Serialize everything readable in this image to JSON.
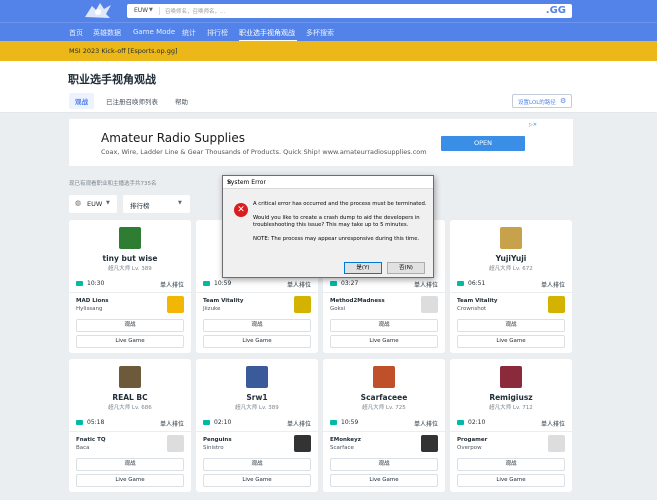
{
  "topbar": {
    "region": "EUW",
    "search_placeholder": "召唤师名，召唤师名，...",
    "brand": ".GG"
  },
  "nav": {
    "items": [
      {
        "label": "首页"
      },
      {
        "label": "英雄数据"
      },
      {
        "label": "Game Mode"
      },
      {
        "label": "统计"
      },
      {
        "label": "排行榜"
      },
      {
        "label": "职业选手视角观战"
      },
      {
        "label": "多杯搜索"
      }
    ]
  },
  "banner": {
    "text": "MSI 2023 Kick-off [Esports.op.gg]"
  },
  "header": {
    "title": "职业选手视角观战",
    "tabs": [
      {
        "label": "观战"
      },
      {
        "label": "已注册召唤师列表"
      },
      {
        "label": "帮助"
      }
    ],
    "settings_label": "设置LOL的路径"
  },
  "ad": {
    "title": "Amateur Radio Supplies",
    "description": "Coax, Wire, Ladder Line & Gear Thousands of Products. Quick Ship! www.amateurradiosupplies.com",
    "button": "OPEN"
  },
  "subtitle": "现已有观看职业和主播选手共735名",
  "filters": {
    "region": "EUW",
    "sort": "排行榜"
  },
  "cards": [
    {
      "name": "tiny but wise",
      "rank": "超凡大师 Lv. 389",
      "time": "10:30",
      "queue": "单人排位",
      "team": "MAD Lions",
      "player": "Hylissang",
      "avatar_color": "#2e7d32",
      "logo_color": "#f2b705",
      "watch": "观战",
      "live": "Live Game"
    },
    {
      "name": "",
      "rank": "",
      "time": "10:59",
      "queue": "单人排位",
      "team": "Team Vitality",
      "player": "Jiizuke",
      "avatar_color": "#777777",
      "logo_color": "#d4b300",
      "watch": "观战",
      "live": "Live Game"
    },
    {
      "name": "",
      "rank": "",
      "time": "03:27",
      "queue": "单人排位",
      "team": "Method2Madness",
      "player": "Goksi",
      "avatar_color": "#777777",
      "logo_color": "#dddddd",
      "watch": "观战",
      "live": "Live Game"
    },
    {
      "name": "YujiYuji",
      "rank": "超凡大师 Lv. 672",
      "time": "06:51",
      "queue": "单人排位",
      "team": "Team Vitality",
      "player": "Crownshot",
      "avatar_color": "#c8a24a",
      "logo_color": "#d4b300",
      "watch": "观战",
      "live": "Live Game"
    },
    {
      "name": "REAL BC",
      "rank": "超凡大师 Lv. 686",
      "time": "05:18",
      "queue": "单人排位",
      "team": "Fnatic TQ",
      "player": "Baca",
      "avatar_color": "#6d5a3a",
      "logo_color": "#dddddd",
      "watch": "观战",
      "live": "Live Game"
    },
    {
      "name": "Srw1",
      "rank": "超凡大师 Lv. 389",
      "time": "02:10",
      "queue": "单人排位",
      "team": "Penguins",
      "player": "Sinistro",
      "avatar_color": "#3a5a9a",
      "logo_color": "#333333",
      "watch": "观战",
      "live": "Live Game"
    },
    {
      "name": "Scarfaceee",
      "rank": "超凡大师 Lv. 725",
      "time": "10:59",
      "queue": "单人排位",
      "team": "EMonkeyz",
      "player": "Scarface",
      "avatar_color": "#c0502a",
      "logo_color": "#333333",
      "watch": "观战",
      "live": "Live Game"
    },
    {
      "name": "Remigiusz",
      "rank": "超凡大师 Lv. 712",
      "time": "02:10",
      "queue": "单人排位",
      "team": "Progamer",
      "player": "Overpow",
      "avatar_color": "#8a2a3a",
      "logo_color": "#dddddd",
      "watch": "观战",
      "live": "Live Game"
    }
  ],
  "dialog": {
    "title": "System Error",
    "close": "✕",
    "message1": "A critical error has occurred and the process must be terminated.",
    "message2": "Would you like to create a crash dump to aid the developers in troubleshooting this issue? This may take up to 5 minutes.",
    "note": "NOTE: The process may appear unresponsive during this time.",
    "yes_label": "是(Y)",
    "no_label": "否(N)"
  }
}
